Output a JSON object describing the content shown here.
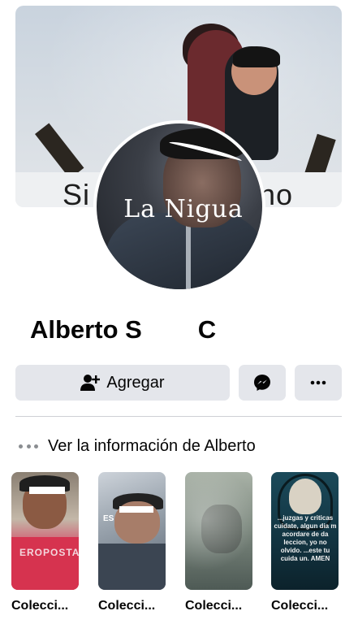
{
  "cover": {
    "caption_left": "Si",
    "caption_right": "no"
  },
  "avatar": {
    "watermark": "La Nigua"
  },
  "profile": {
    "name": "Alberto S        C"
  },
  "actions": {
    "add_label": "Agregar"
  },
  "info": {
    "text": "Ver la información de Alberto"
  },
  "collections": [
    {
      "label": "Colecci...",
      "overlay_text": "EROPOSTAL"
    },
    {
      "label": "Colecci...",
      "overlay_text": "ES"
    },
    {
      "label": "Colecci..."
    },
    {
      "label": "Colecci...",
      "overlay_text": "...juzgas y criticas cuidate, algun dia m acordare de da leccion, yo no olvido. ...este tu cuida un. AMEN"
    }
  ]
}
